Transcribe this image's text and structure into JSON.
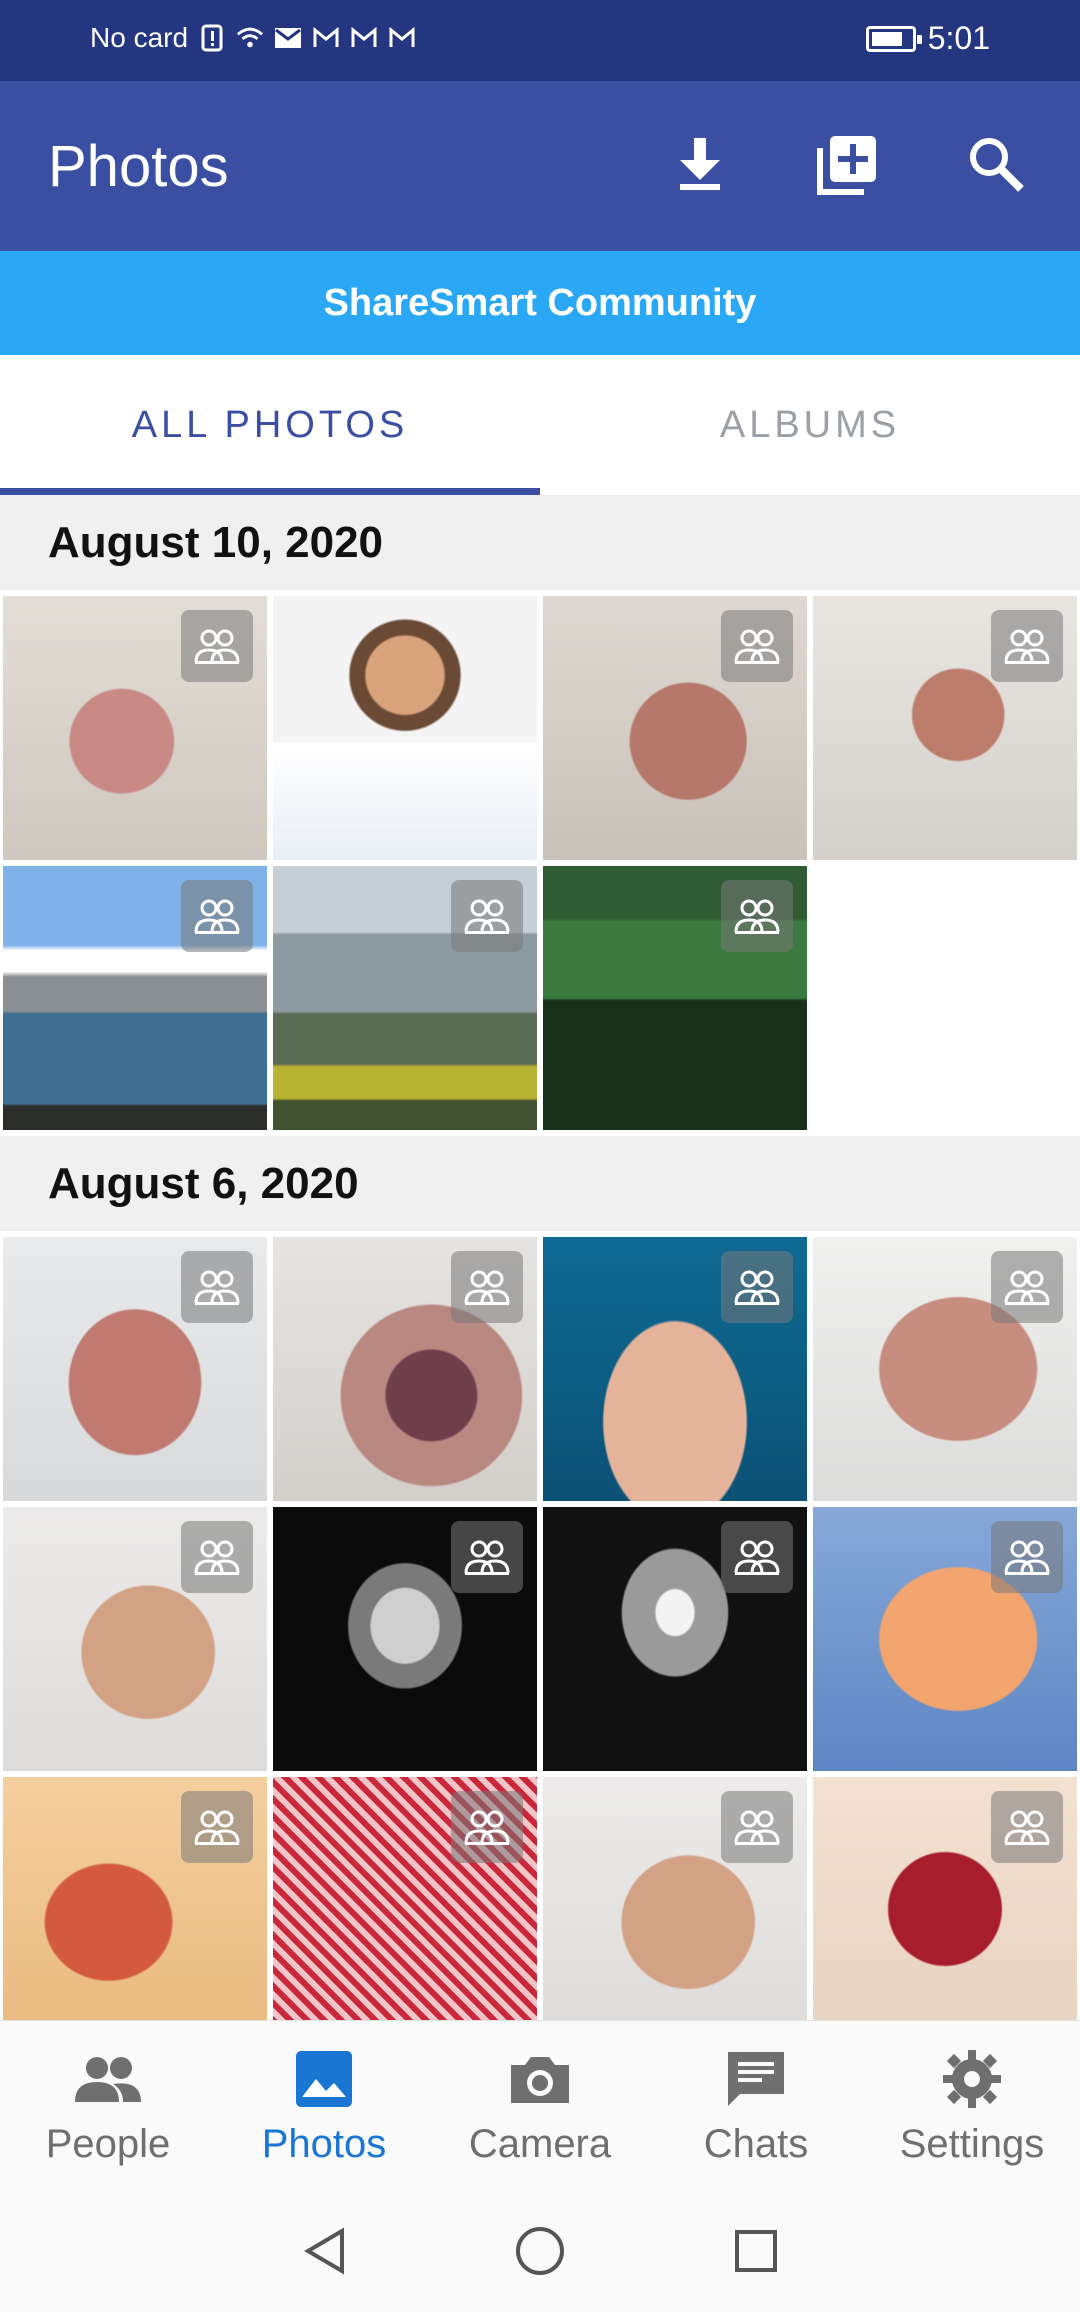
{
  "status_bar": {
    "carrier": "No card",
    "time": "5:01"
  },
  "app_bar": {
    "title": "Photos",
    "actions": [
      {
        "name": "download",
        "icon": "download-icon"
      },
      {
        "name": "add",
        "icon": "add-box-icon"
      },
      {
        "name": "search",
        "icon": "search-icon"
      }
    ]
  },
  "community": {
    "name": "ShareSmart Community"
  },
  "tabs": [
    {
      "label": "ALL PHOTOS",
      "active": true
    },
    {
      "label": "ALBUMS",
      "active": false
    }
  ],
  "sections": [
    {
      "date": "August 10, 2020",
      "photos": [
        {
          "style": "p-hand1",
          "shared": true
        },
        {
          "style": "p-doctor",
          "shared": false
        },
        {
          "style": "p-hand2",
          "shared": true
        },
        {
          "style": "p-hand3",
          "shared": true
        },
        {
          "style": "p-lake",
          "shared": true
        },
        {
          "style": "p-mountain",
          "shared": true
        },
        {
          "style": "p-forest",
          "shared": true
        }
      ]
    },
    {
      "date": "August 6, 2020",
      "photos": [
        {
          "style": "p-burn1",
          "shared": true
        },
        {
          "style": "p-burn2",
          "shared": true
        },
        {
          "style": "p-blue",
          "shared": true
        },
        {
          "style": "p-palm",
          "shared": true
        },
        {
          "style": "p-thumb",
          "shared": true
        },
        {
          "style": "p-xray1",
          "shared": true
        },
        {
          "style": "p-xray2",
          "shared": true
        },
        {
          "style": "p-orange",
          "shared": true
        },
        {
          "style": "p-arm1",
          "shared": true
        },
        {
          "style": "p-arm2",
          "shared": true
        },
        {
          "style": "p-thumb",
          "shared": true
        },
        {
          "style": "p-arm3",
          "shared": true
        }
      ]
    }
  ],
  "bottom_nav": [
    {
      "label": "People",
      "icon": "people-icon",
      "active": false
    },
    {
      "label": "Photos",
      "icon": "photo-icon",
      "active": true
    },
    {
      "label": "Camera",
      "icon": "camera-icon",
      "active": false
    },
    {
      "label": "Chats",
      "icon": "chat-icon",
      "active": false
    },
    {
      "label": "Settings",
      "icon": "gear-icon",
      "active": false
    }
  ],
  "colors": {
    "status_bar": "#253681",
    "app_bar": "#3a4fa1",
    "community_banner": "#2aa8f5",
    "active_tab": "#3a4fa1",
    "active_nav": "#1976d2"
  }
}
